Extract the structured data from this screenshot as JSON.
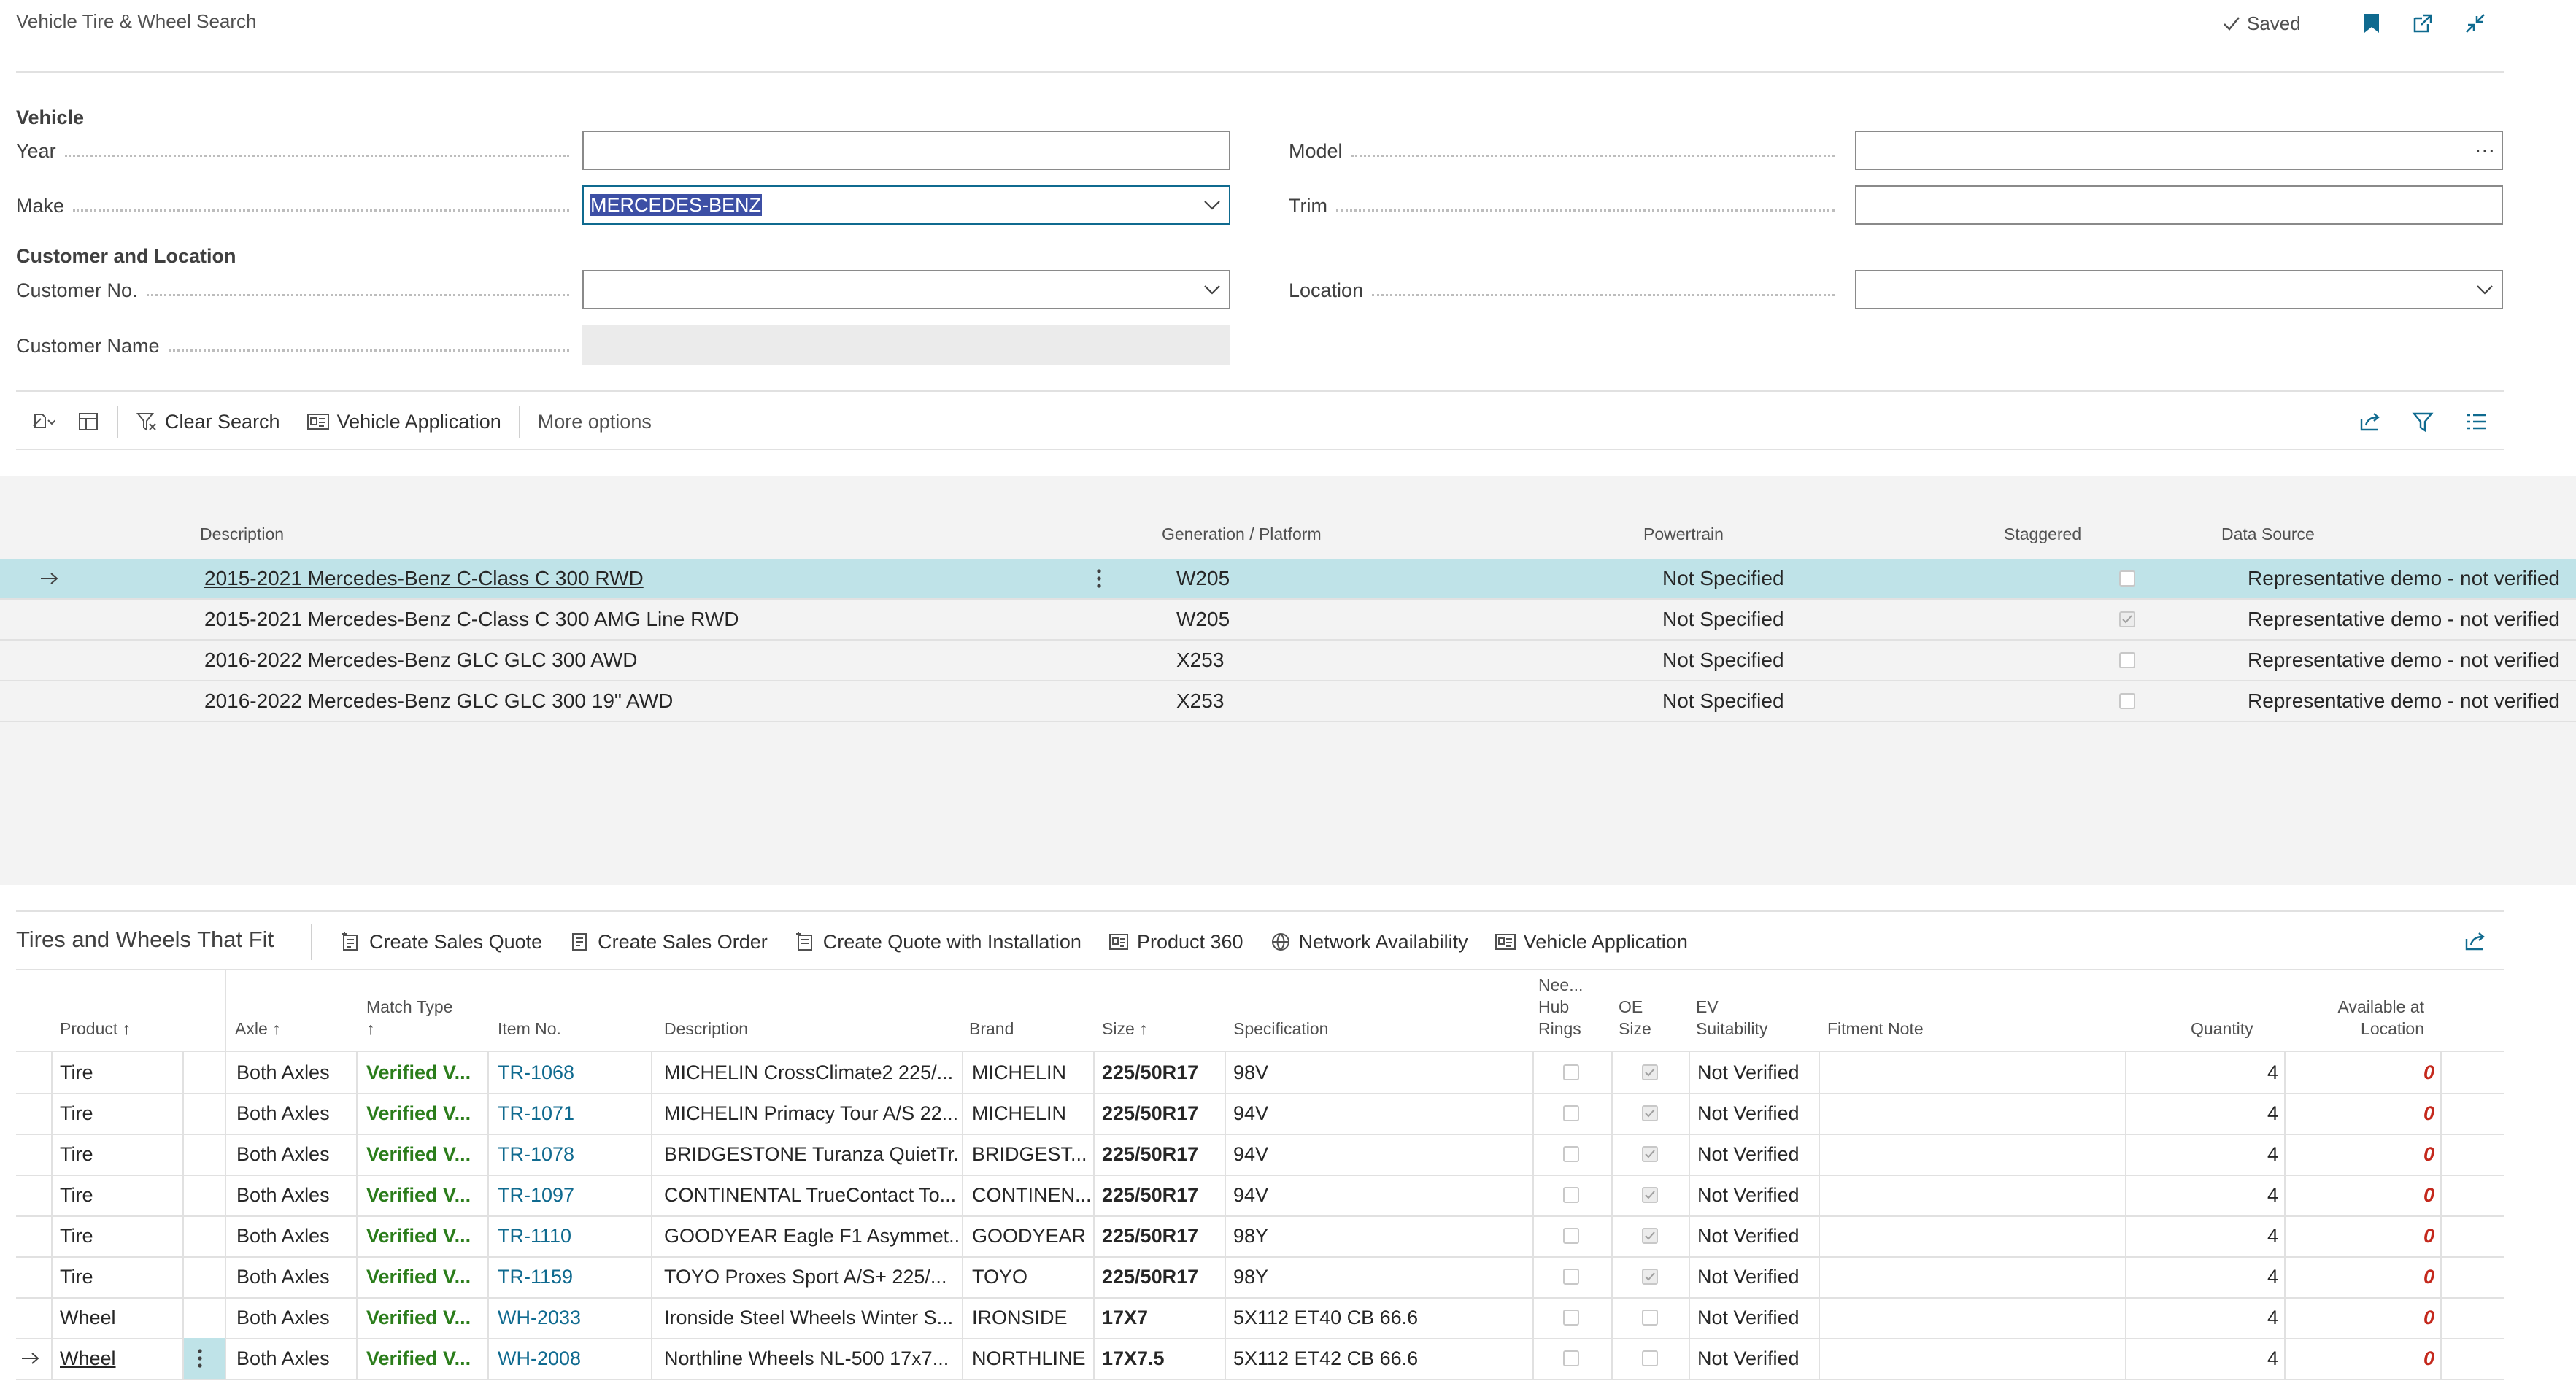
{
  "header": {
    "title": "Vehicle Tire & Wheel Search",
    "saved": "Saved"
  },
  "vehicle": {
    "section": "Vehicle",
    "year_label": "Year",
    "year_value": "",
    "make_label": "Make",
    "make_value": "MERCEDES-BENZ",
    "model_label": "Model",
    "model_value": "",
    "trim_label": "Trim",
    "trim_value": ""
  },
  "customer": {
    "section": "Customer and Location",
    "no_label": "Customer No.",
    "no_value": "",
    "name_label": "Customer Name",
    "name_value": "",
    "location_label": "Location",
    "location_value": ""
  },
  "toolbar": {
    "clear_search": "Clear Search",
    "vehicle_application": "Vehicle Application",
    "more_options": "More options"
  },
  "vehicles_grid": {
    "columns": [
      "Description",
      "Generation / Platform",
      "Powertrain",
      "Staggered",
      "Data Source"
    ],
    "rows": [
      {
        "description": "2015-2021 Mercedes-Benz C-Class C 300 RWD",
        "platform": "W205",
        "powertrain": "Not Specified",
        "staggered": false,
        "source": "Representative demo - not verified"
      },
      {
        "description": "2015-2021 Mercedes-Benz C-Class C 300 AMG Line RWD",
        "platform": "W205",
        "powertrain": "Not Specified",
        "staggered": true,
        "source": "Representative demo - not verified"
      },
      {
        "description": "2016-2022 Mercedes-Benz GLC GLC 300 AWD",
        "platform": "X253",
        "powertrain": "Not Specified",
        "staggered": false,
        "source": "Representative demo - not verified"
      },
      {
        "description": "2016-2022 Mercedes-Benz GLC GLC 300 19\" AWD",
        "platform": "X253",
        "powertrain": "Not Specified",
        "staggered": false,
        "source": "Representative demo - not verified"
      }
    ]
  },
  "fit_part": {
    "title": "Tires and Wheels That Fit",
    "actions": [
      "Create Sales Quote",
      "Create Sales Order",
      "Create Quote with Installation",
      "Product 360",
      "Network Availability",
      "Vehicle Application"
    ],
    "columns": {
      "product": "Product",
      "axle": "Axle",
      "match_type": "Match Type",
      "item_no": "Item No.",
      "description": "Description",
      "brand": "Brand",
      "size": "Size",
      "specification": "Specification",
      "hub_rings_1": "Nee...",
      "hub_rings_2": "Hub",
      "hub_rings_3": "Rings",
      "oe_1": "OE",
      "oe_2": "Size",
      "ev_1": "EV",
      "ev_2": "Suitability",
      "fitment_note": "Fitment Note",
      "quantity": "Quantity",
      "available_1": "Available at",
      "available_2": "Location"
    },
    "rows": [
      {
        "product": "Tire",
        "axle": "Both Axles",
        "match": "Verified V...",
        "item": "TR-1068",
        "desc": "MICHELIN CrossClimate2 225/...",
        "brand": "MICHELIN",
        "size": "225/50R17",
        "spec": "98V",
        "hub": false,
        "oe": true,
        "ev": "Not Verified",
        "note": "",
        "qty": "4",
        "avail": "0"
      },
      {
        "product": "Tire",
        "axle": "Both Axles",
        "match": "Verified V...",
        "item": "TR-1071",
        "desc": "MICHELIN Primacy Tour A/S 22...",
        "brand": "MICHELIN",
        "size": "225/50R17",
        "spec": "94V",
        "hub": false,
        "oe": true,
        "ev": "Not Verified",
        "note": "",
        "qty": "4",
        "avail": "0"
      },
      {
        "product": "Tire",
        "axle": "Both Axles",
        "match": "Verified V...",
        "item": "TR-1078",
        "desc": "BRIDGESTONE Turanza QuietTr...",
        "brand": "BRIDGEST...",
        "size": "225/50R17",
        "spec": "94V",
        "hub": false,
        "oe": true,
        "ev": "Not Verified",
        "note": "",
        "qty": "4",
        "avail": "0"
      },
      {
        "product": "Tire",
        "axle": "Both Axles",
        "match": "Verified V...",
        "item": "TR-1097",
        "desc": "CONTINENTAL TrueContact To...",
        "brand": "CONTINEN...",
        "size": "225/50R17",
        "spec": "94V",
        "hub": false,
        "oe": true,
        "ev": "Not Verified",
        "note": "",
        "qty": "4",
        "avail": "0"
      },
      {
        "product": "Tire",
        "axle": "Both Axles",
        "match": "Verified V...",
        "item": "TR-1110",
        "desc": "GOODYEAR Eagle F1 Asymmet...",
        "brand": "GOODYEAR",
        "size": "225/50R17",
        "spec": "98Y",
        "hub": false,
        "oe": true,
        "ev": "Not Verified",
        "note": "",
        "qty": "4",
        "avail": "0"
      },
      {
        "product": "Tire",
        "axle": "Both Axles",
        "match": "Verified V...",
        "item": "TR-1159",
        "desc": "TOYO Proxes Sport A/S+ 225/...",
        "brand": "TOYO",
        "size": "225/50R17",
        "spec": "98Y",
        "hub": false,
        "oe": true,
        "ev": "Not Verified",
        "note": "",
        "qty": "4",
        "avail": "0"
      },
      {
        "product": "Wheel",
        "axle": "Both Axles",
        "match": "Verified V...",
        "item": "WH-2033",
        "desc": "Ironside Steel Wheels Winter S...",
        "brand": "IRONSIDE",
        "size": "17X7",
        "spec": "5X112 ET40 CB 66.6",
        "hub": false,
        "oe": false,
        "ev": "Not Verified",
        "note": "",
        "qty": "4",
        "avail": "0"
      },
      {
        "product": "Wheel",
        "axle": "Both Axles",
        "match": "Verified V...",
        "item": "WH-2008",
        "desc": "Northline Wheels NL-500 17x7...",
        "brand": "NORTHLINE",
        "size": "17X7.5",
        "spec": "5X112 ET42 CB 66.6",
        "hub": false,
        "oe": false,
        "ev": "Not Verified",
        "note": "",
        "qty": "4",
        "avail": "0"
      }
    ]
  }
}
